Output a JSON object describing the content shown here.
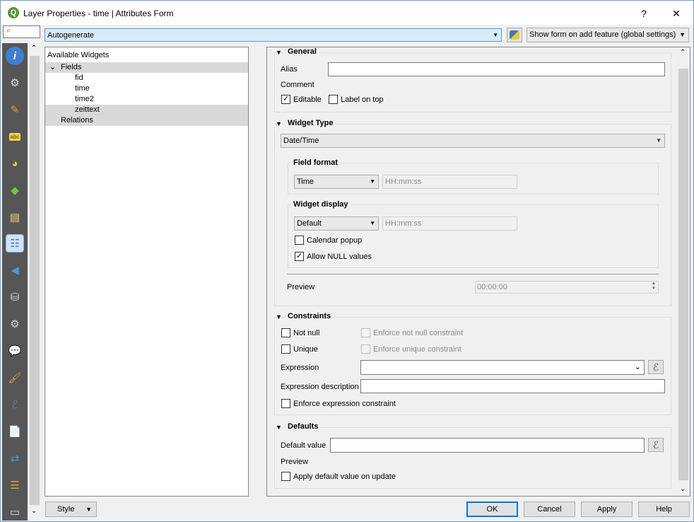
{
  "window": {
    "title": "Layer Properties - time | Attributes Form",
    "help": "?",
    "close": "✕"
  },
  "top": {
    "search_placeholder": "",
    "layout_mode": "Autogenerate",
    "python_icon": "python-icon",
    "show_form_option": "Show form on add feature (global settings)"
  },
  "sidebar": {
    "icons": [
      "information-icon",
      "source-icon",
      "symbology-icon",
      "labels-icon",
      "diagrams-icon",
      "3d-view-icon",
      "source-fields-icon",
      "attributes-form-icon",
      "joins-icon",
      "auxiliary-storage-icon",
      "actions-icon",
      "display-icon",
      "rendering-icon",
      "variables-icon",
      "metadata-icon",
      "dependencies-icon",
      "legend-icon",
      "qgis-server-icon"
    ]
  },
  "tree": {
    "header": "Available Widgets",
    "fields_label": "Fields",
    "fields": [
      "fid",
      "time",
      "time2",
      "zeittext"
    ],
    "relations_label": "Relations"
  },
  "general": {
    "title": "General",
    "alias_label": "Alias",
    "alias_value": "",
    "comment_label": "Comment",
    "editable_label": "Editable",
    "editable_checked": true,
    "label_on_top_label": "Label on top",
    "label_on_top_checked": false
  },
  "widget_type": {
    "title": "Widget Type",
    "value": "Date/Time",
    "field_format_title": "Field format",
    "field_format_value": "Time",
    "field_format_pattern": "HH:mm:ss",
    "widget_display_title": "Widget display",
    "widget_display_value": "Default",
    "widget_display_pattern": "HH:mm:ss",
    "calendar_popup_label": "Calendar popup",
    "calendar_popup_checked": false,
    "allow_null_label": "Allow NULL values",
    "allow_null_checked": true,
    "preview_label": "Preview",
    "preview_value": "00:00:00"
  },
  "constraints": {
    "title": "Constraints",
    "not_null_label": "Not null",
    "enforce_not_null_label": "Enforce not null constraint",
    "unique_label": "Unique",
    "enforce_unique_label": "Enforce unique constraint",
    "expression_label": "Expression",
    "expression_value": "",
    "expression_description_label": "Expression description",
    "expression_description_value": "",
    "enforce_expression_label": "Enforce expression constraint"
  },
  "defaults": {
    "title": "Defaults",
    "default_value_label": "Default value",
    "default_value": "",
    "preview_label": "Preview",
    "apply_on_update_label": "Apply default value on update"
  },
  "bottom": {
    "style_label": "Style",
    "ok_label": "OK",
    "cancel_label": "Cancel",
    "apply_label": "Apply",
    "help_label": "Help"
  },
  "colors": {
    "selection": "#cce8ff",
    "layout_combo": "#d9ebf9",
    "sidebar": "#565656"
  }
}
